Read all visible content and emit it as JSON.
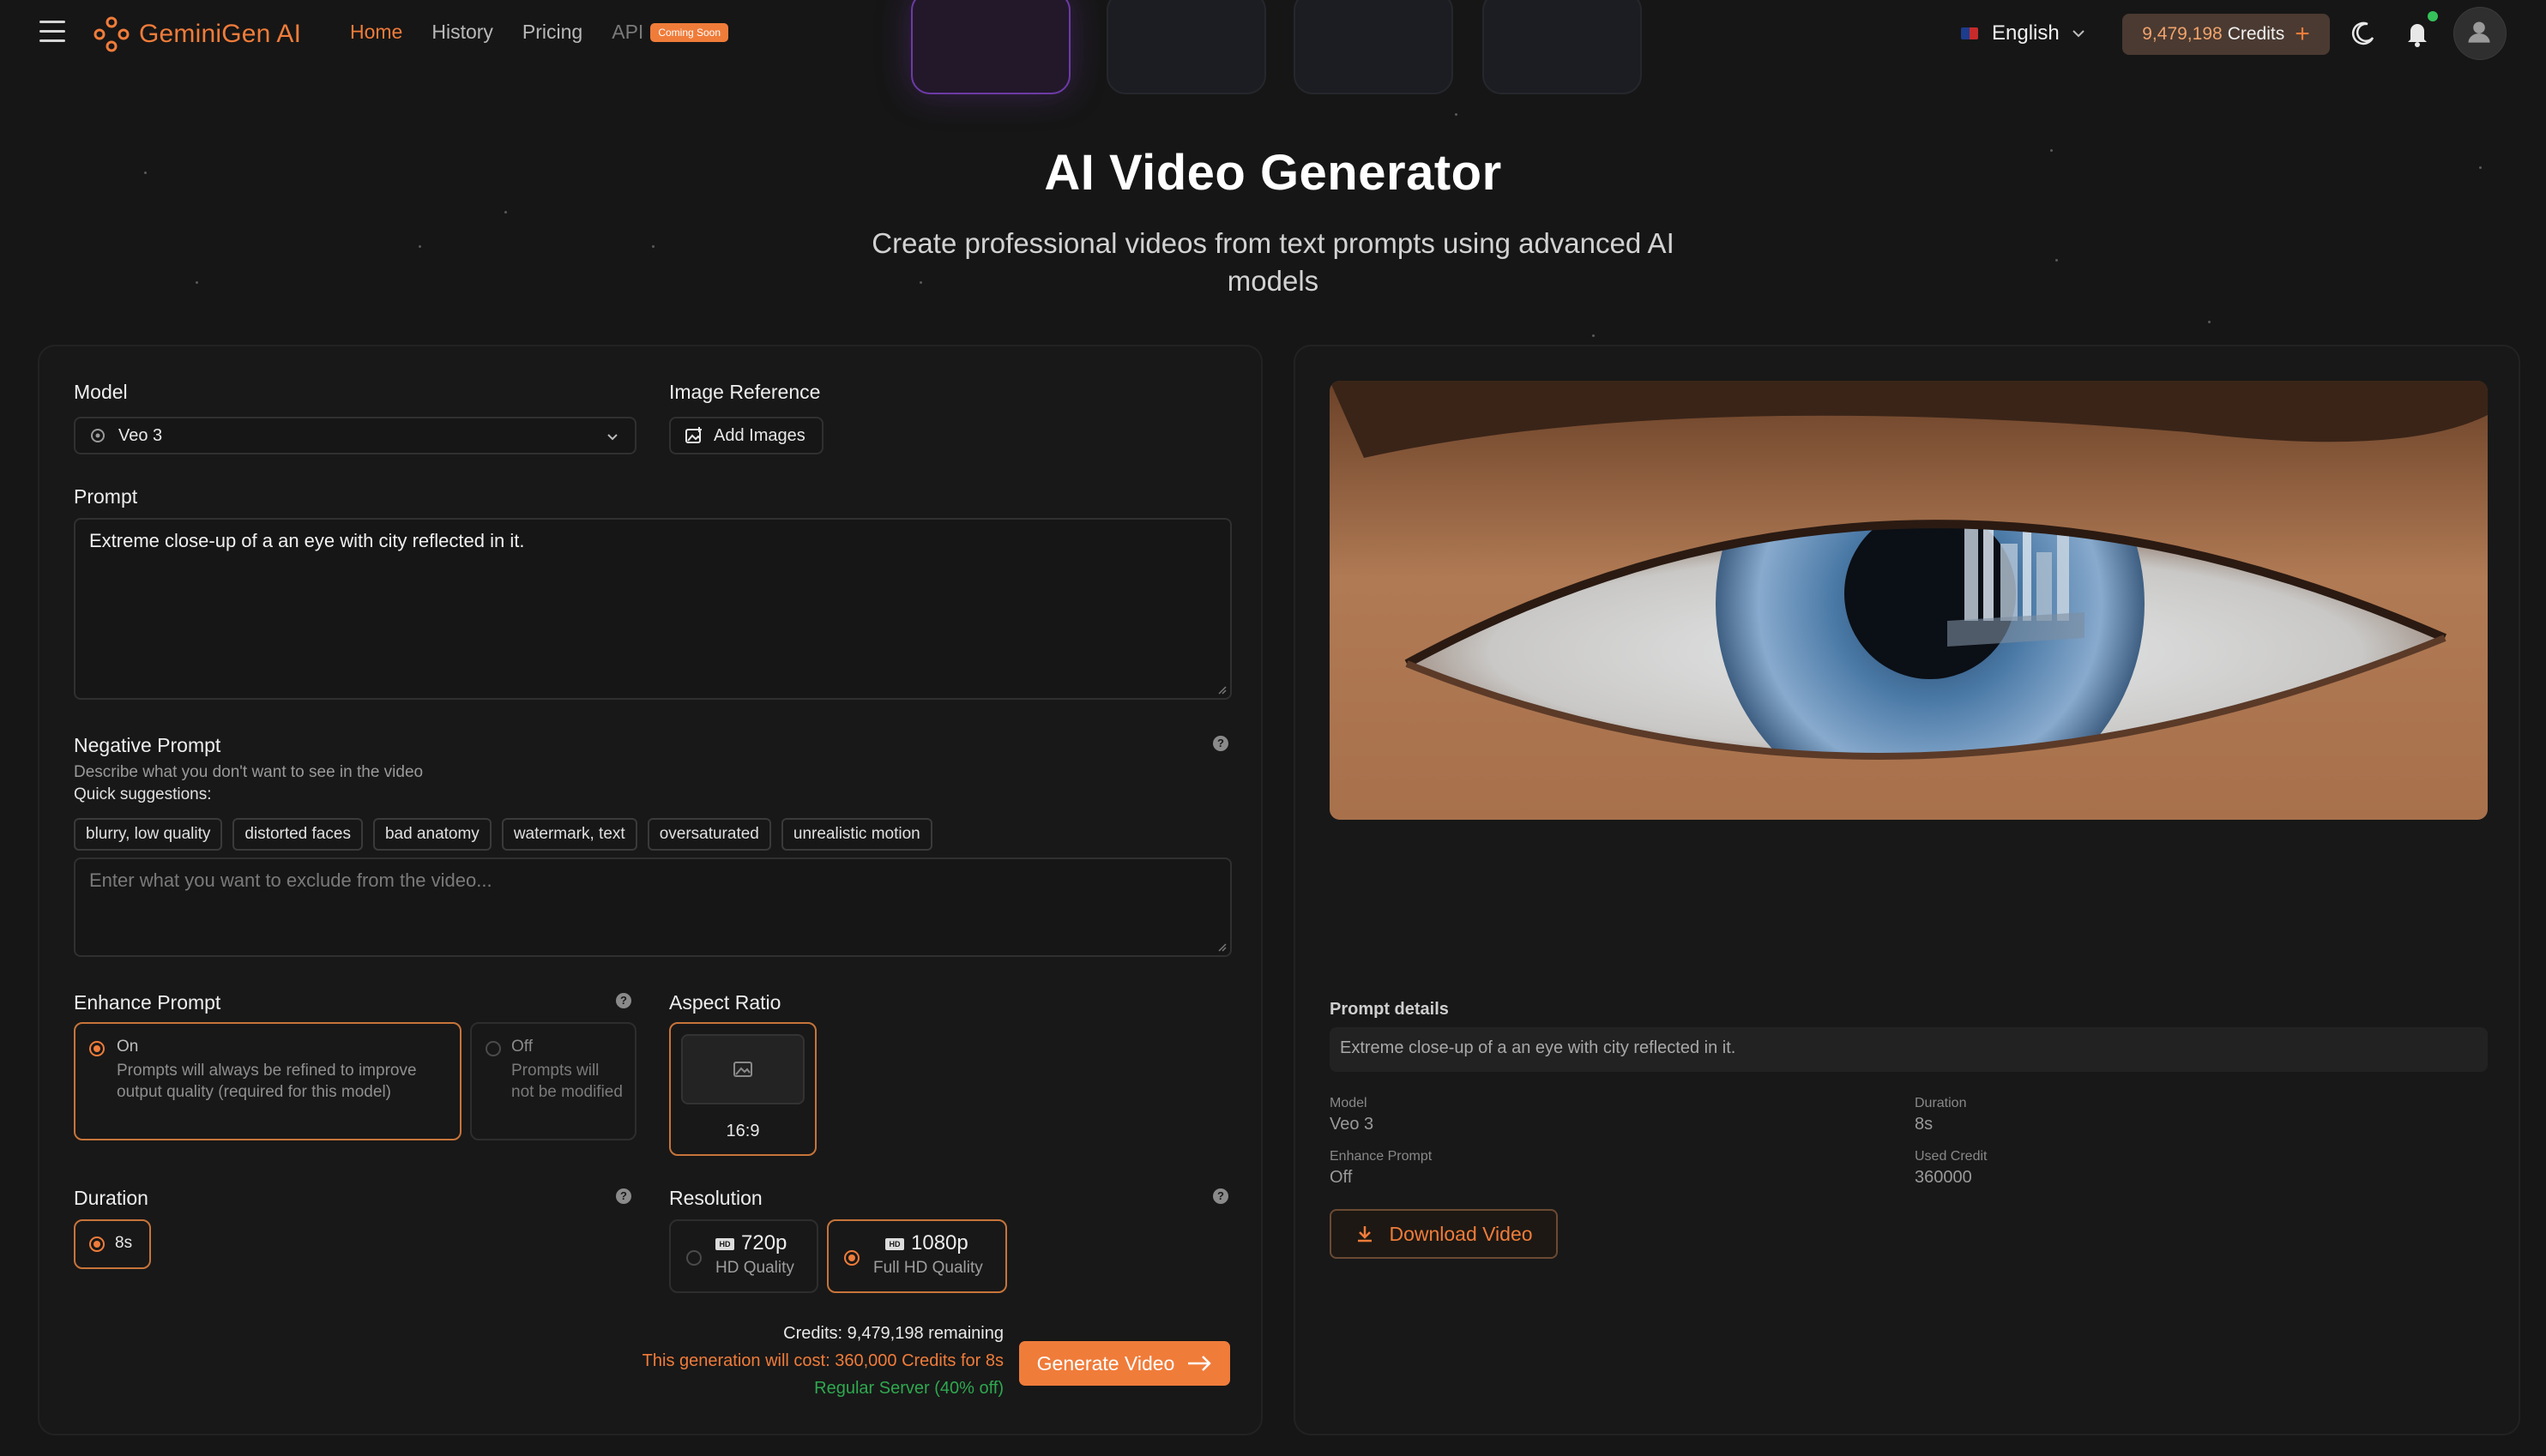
{
  "nav": {
    "brand": "GeminiGen AI",
    "links": [
      "Home",
      "History",
      "Pricing"
    ],
    "api_label": "API",
    "api_badge": "Coming Soon",
    "language": "English",
    "credits_value": "9,479,198",
    "credits_word": "Credits"
  },
  "hero": {
    "title": "AI Video Generator",
    "subtitle": "Create professional videos from text prompts using advanced AI models"
  },
  "form": {
    "model_label": "Model",
    "model_value": "Veo 3",
    "image_ref_label": "Image Reference",
    "add_images_label": "Add Images",
    "prompt_label": "Prompt",
    "prompt_value": "Extreme close-up of a an eye with city reflected in it.",
    "negative_label": "Negative Prompt",
    "negative_desc": "Describe what you don't want to see in the video",
    "quick_suggestions_label": "Quick suggestions:",
    "suggestions": [
      "blurry, low quality",
      "distorted faces",
      "bad anatomy",
      "watermark, text",
      "oversaturated",
      "unrealistic motion"
    ],
    "negative_placeholder": "Enter what you want to exclude from the video...",
    "enhance_label": "Enhance Prompt",
    "enhance_on_title": "On",
    "enhance_on_desc": "Prompts will always be refined to improve output quality (required for this model)",
    "enhance_off_title": "Off",
    "enhance_off_desc": "Prompts will not be modified",
    "enhance_selected": "On",
    "aspect_label": "Aspect Ratio",
    "aspect_value": "16:9",
    "duration_label": "Duration",
    "duration_value": "8s",
    "resolution_label": "Resolution",
    "res_720_title": "720p",
    "res_720_sub": "HD Quality",
    "res_1080_title": "1080p",
    "res_1080_sub": "Full HD Quality",
    "resolution_selected": "1080p",
    "hd_badge": "HD",
    "credits_remaining": "Credits: 9,479,198 remaining",
    "cost_text": "This generation will cost: 360,000 Credits for 8s",
    "server_text": "Regular Server (40% off)",
    "generate_label": "Generate Video"
  },
  "result": {
    "prompt_details_label": "Prompt details",
    "prompt_details_value": "Extreme close-up of a an eye with city reflected in it.",
    "model_key": "Model",
    "model_value": "Veo 3",
    "duration_key": "Duration",
    "duration_value": "8s",
    "enhance_key": "Enhance Prompt",
    "enhance_value": "Off",
    "used_credit_key": "Used Credit",
    "used_credit_value": "360000",
    "download_label": "Download Video"
  },
  "colors": {
    "accent": "#f07c3a",
    "background": "#161616",
    "panel": "#181818",
    "success": "#2fa84f"
  },
  "icons": [
    "menu-icon",
    "brand-logo-icon",
    "flag-uk-icon",
    "chevron-down-icon",
    "plus-icon",
    "moon-icon",
    "bell-icon",
    "user-icon",
    "gear-icon",
    "image-add-icon",
    "help-icon",
    "image-icon",
    "hd-icon",
    "arrow-right-icon",
    "download-icon"
  ]
}
